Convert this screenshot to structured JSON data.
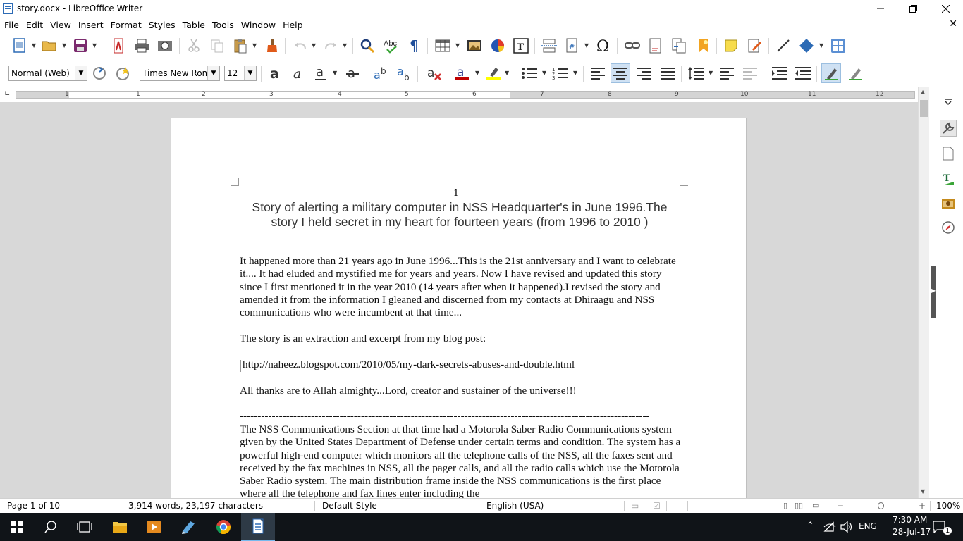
{
  "window": {
    "title": "story.docx - LibreOffice Writer"
  },
  "menu": [
    "File",
    "Edit",
    "View",
    "Insert",
    "Format",
    "Styles",
    "Table",
    "Tools",
    "Window",
    "Help"
  ],
  "formatting": {
    "paragraph_style": "Normal (Web)",
    "font_name": "Times New Roma",
    "font_size": "12"
  },
  "ruler": {
    "numbers": [
      "1",
      "1",
      "2",
      "3",
      "4",
      "5",
      "6",
      "7",
      "8",
      "9",
      "10",
      "11",
      "12"
    ]
  },
  "document": {
    "page_number": "1",
    "heading": "Story of alerting a military computer in NSS Headquarter's in June 1996.The story I held secret in my heart for fourteen years (from 1996 to 2010 )",
    "paragraphs": [
      "It happened more than 21 years ago in June 1996...This is the 21st anniversary and I want to celebrate it.... It had eluded and mystified me for years and years. Now I have revised and updated this story since I first mentioned it in the year 2010 (14 years after when it happened).I revised the story and amended it from the information I gleaned and discerned from my contacts at Dhiraagu and NSS communications who were incumbent at that time...",
      "The story is an extraction and excerpt from my blog post:",
      "http://naheez.blogspot.com/2010/05/my-dark-secrets-abuses-and-double.html",
      "All thanks are to Allah almighty...Lord, creator and sustainer of the universe!!!",
      "-------------------------------------------------------------------------------------------------------------------",
      "The NSS Communications Section at that time had a Motorola Saber Radio Communications system given by the United States Department of Defense under certain terms and condition. The system has a powerful high-end computer which monitors all the telephone calls of the NSS, all the faxes sent and received by the fax machines in NSS, all the pager calls, and all the radio calls which use the Motorola Saber Radio system. The main distribution frame inside the NSS communications is the first place where all the telephone and fax lines enter including the"
    ]
  },
  "status": {
    "page": "Page 1 of 10",
    "words": "3,914 words, 23,197 characters",
    "page_style": "Default Style",
    "language": "English (USA)",
    "zoom": "100%"
  },
  "taskbar": {
    "lang": "ENG",
    "time": "7:30 AM",
    "date": "28-Jul-17",
    "notifications": "1"
  },
  "colors": {
    "accent": "#2d6bb5",
    "font_color": "#c00000",
    "highlight": "#ffff00",
    "taskbar_bg": "#101418"
  }
}
